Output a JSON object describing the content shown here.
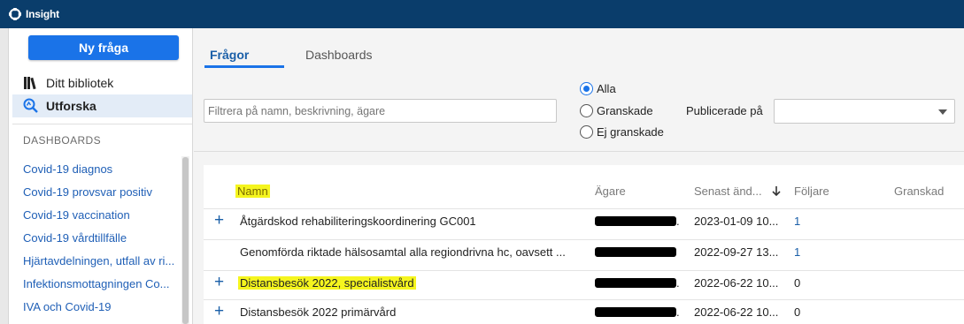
{
  "app": {
    "title": "Insight"
  },
  "sidebar": {
    "new_question": "Ny fråga",
    "nav": [
      {
        "label": "Ditt bibliotek"
      },
      {
        "label": "Utforska"
      }
    ],
    "section_title": "DASHBOARDS",
    "dashboards": [
      "Covid-19 diagnos",
      "Covid-19 provsvar positiv",
      "Covid-19 vaccination",
      "Covid-19 vårdtillfälle",
      "Hjärtavdelningen, utfall av ri...",
      "Infektionsmottagningen Co...",
      "IVA och Covid-19"
    ]
  },
  "tabs": [
    {
      "label": "Frågor",
      "active": true
    },
    {
      "label": "Dashboards",
      "active": false
    }
  ],
  "filter": {
    "placeholder": "Filtrera på namn, beskrivning, ägare",
    "radios": [
      {
        "label": "Alla",
        "selected": true
      },
      {
        "label": "Granskade",
        "selected": false
      },
      {
        "label": "Ej granskade",
        "selected": false
      }
    ],
    "published_label": "Publicerade på",
    "published_value": ""
  },
  "table": {
    "columns": [
      "Namn",
      "Ägare",
      "Senast änd...",
      "Följare",
      "Granskad"
    ],
    "sort_icon": "arrow-down-icon",
    "rows": [
      {
        "name": "Åtgärdskod rehabiliteringskoordinering GC001",
        "plus": true,
        "owner_tail": ".",
        "modified": "2023-01-09 10...",
        "followers": "1",
        "highlighted": false
      },
      {
        "name": "Genomförda riktade hälsosamtal alla regiondrivna hc, oavsett ...",
        "plus": false,
        "owner_tail": "",
        "modified": "2022-09-27 13...",
        "followers": "1",
        "highlighted": false
      },
      {
        "name": "Distansbesök 2022, specialistvård",
        "plus": true,
        "owner_tail": ".",
        "modified": "2022-06-22 10...",
        "followers": "0",
        "highlighted": true
      },
      {
        "name": "Distansbesök 2022 primärvård",
        "plus": true,
        "owner_tail": ".",
        "modified": "2022-06-22 10...",
        "followers": "0",
        "highlighted": false
      }
    ]
  },
  "colors": {
    "topbar": "#0a3d6b",
    "accent": "#1a73e8",
    "link": "#1f5fb6",
    "highlight": "#f5f51e"
  }
}
